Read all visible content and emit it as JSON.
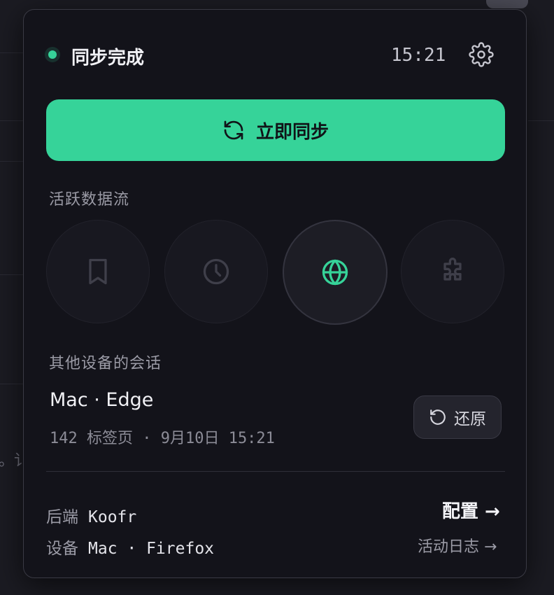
{
  "status": {
    "text": "同步完成",
    "time": "15:21",
    "color": "#36d399"
  },
  "sync_button": {
    "label": "立即同步",
    "icon": "refresh-icon"
  },
  "streams": {
    "label": "活跃数据流",
    "items": [
      {
        "name": "bookmark-icon",
        "active": false
      },
      {
        "name": "clock-icon",
        "active": false
      },
      {
        "name": "globe-icon",
        "active": true
      },
      {
        "name": "puzzle-icon",
        "active": false
      }
    ]
  },
  "sessions": {
    "label": "其他设备的会话",
    "title": "Mac · Edge",
    "meta": "142 标签页 · 9月10日 15:21",
    "restore_label": "还原"
  },
  "footer": {
    "backend_key": "后端",
    "backend_value": "Koofr",
    "device_key": "设备",
    "device_value": "Mac · Firefox",
    "config_label": "配置 →",
    "log_label": "活动日志 →"
  },
  "background": {
    "edge_text": "。讠"
  },
  "colors": {
    "accent": "#36d399",
    "panel": "#13131a"
  }
}
